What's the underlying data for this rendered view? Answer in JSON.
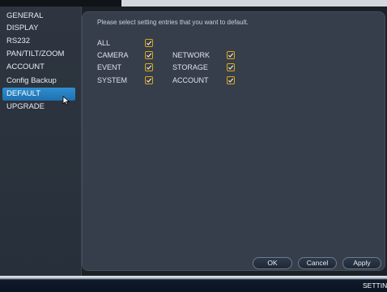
{
  "sidebar": {
    "items": [
      {
        "label": "GENERAL",
        "active": false
      },
      {
        "label": "DISPLAY",
        "active": false
      },
      {
        "label": "RS232",
        "active": false
      },
      {
        "label": "PAN/TILT/ZOOM",
        "active": false
      },
      {
        "label": "ACCOUNT",
        "active": false
      },
      {
        "label": "Config Backup",
        "active": false
      },
      {
        "label": "DEFAULT",
        "active": true
      },
      {
        "label": "UPGRADE",
        "active": false
      }
    ]
  },
  "main": {
    "instruction": "Please select setting entries that you want to default.",
    "options": {
      "all": {
        "label": "ALL",
        "checked": true
      },
      "camera": {
        "label": "CAMERA",
        "checked": true
      },
      "network": {
        "label": "NETWORK",
        "checked": true
      },
      "event": {
        "label": "EVENT",
        "checked": true
      },
      "storage": {
        "label": "STORAGE",
        "checked": true
      },
      "system": {
        "label": "SYSTEM",
        "checked": true
      },
      "account": {
        "label": "ACCOUNT",
        "checked": true
      }
    },
    "buttons": {
      "ok": "OK",
      "cancel": "Cancel",
      "apply": "Apply"
    }
  },
  "bottom_bar": {
    "label": "SETTIN"
  },
  "colors": {
    "accent": "#2a86c8",
    "checkbox_border": "#d9a623",
    "panel": "#363e4b"
  }
}
